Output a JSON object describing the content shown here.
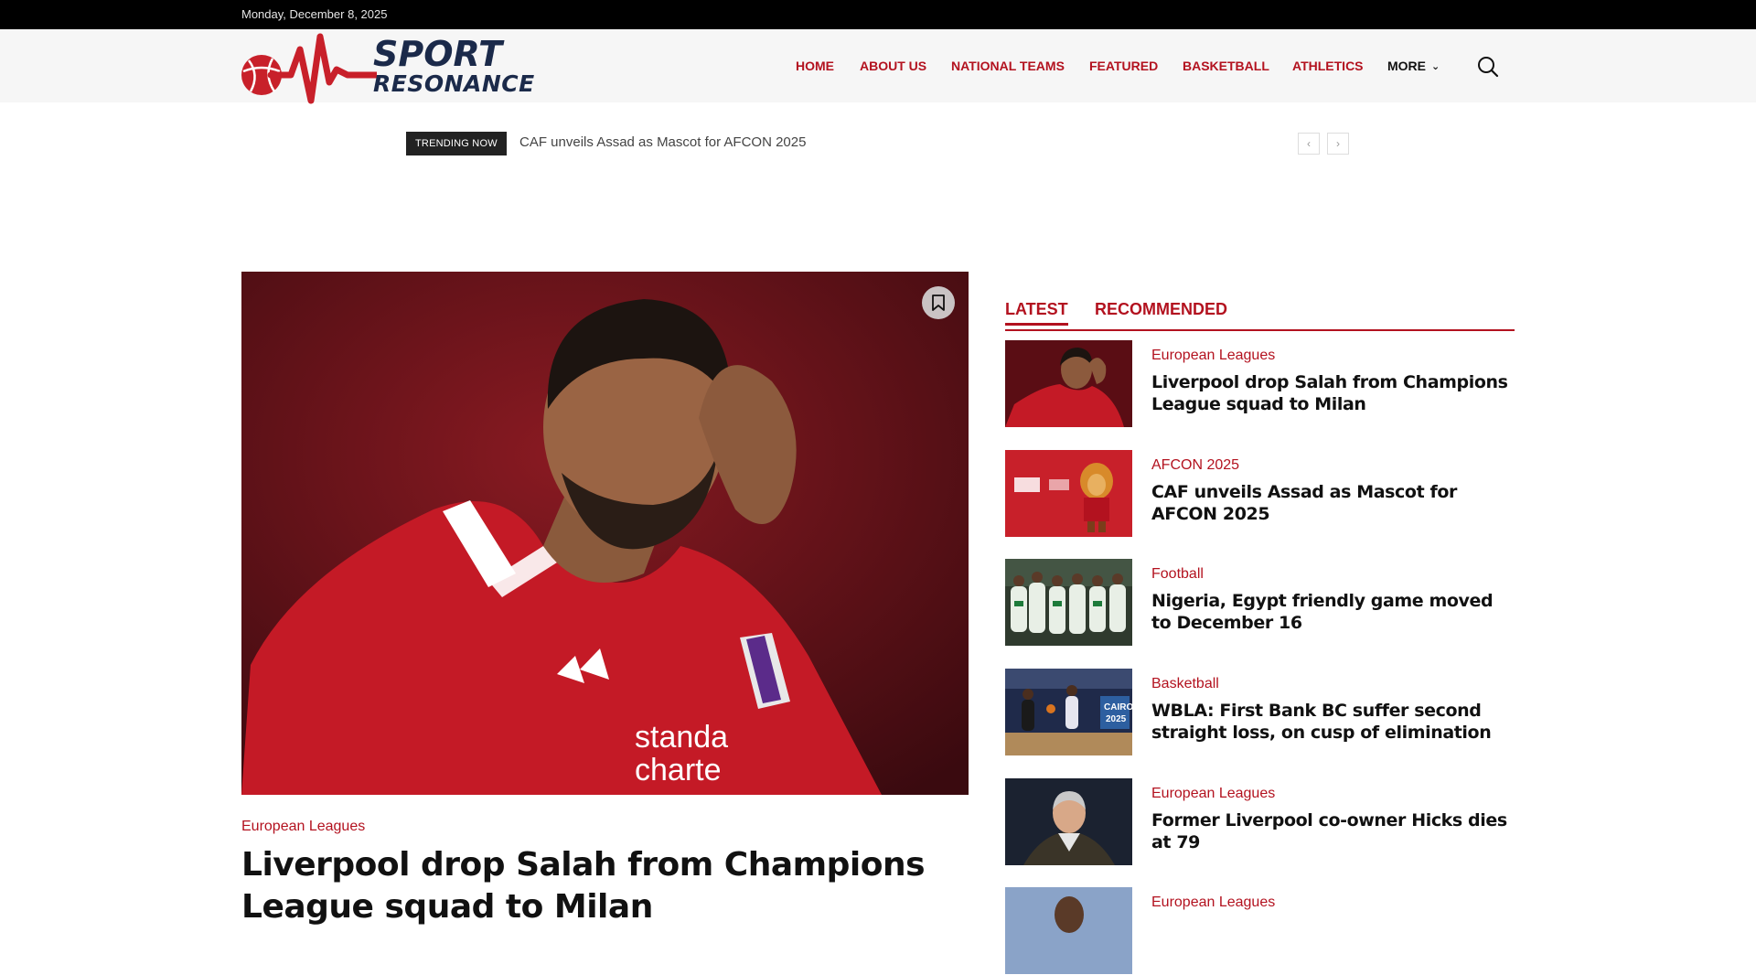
{
  "topbar": {
    "date": "Monday, December 8, 2025"
  },
  "logo": {
    "line1": "SPORT",
    "line2": "RESONANCE"
  },
  "nav": {
    "items": [
      "HOME",
      "ABOUT US",
      "NATIONAL TEAMS",
      "FEATURED",
      "BASKETBALL",
      "ATHLETICS",
      "MORE"
    ],
    "search_icon": "search-icon"
  },
  "trending": {
    "label": "TRENDING NOW",
    "headline": "CAF unveils Assad as Mascot for AFCON 2025",
    "prev": "‹",
    "next": "›"
  },
  "hero": {
    "category": "European Leagues",
    "title": "Liverpool drop Salah from Champions League squad to Milan"
  },
  "sidebar": {
    "tabs": [
      "LATEST",
      "RECOMMENDED"
    ],
    "posts": [
      {
        "category": "European Leagues",
        "title": "Liverpool drop Salah from Champions League squad to Milan"
      },
      {
        "category": "AFCON 2025",
        "title": "CAF unveils Assad as Mascot for AFCON 2025"
      },
      {
        "category": "Football",
        "title": "Nigeria, Egypt friendly game moved to December 16"
      },
      {
        "category": "Basketball",
        "title": "WBLA: First Bank BC suffer second straight loss, on cusp of elimination"
      },
      {
        "category": "European Leagues",
        "title": "Former Liverpool co-owner Hicks dies at 79"
      },
      {
        "category": "European Leagues",
        "title": ""
      }
    ]
  },
  "colors": {
    "brand_red": "#b3121f",
    "navy": "#1b2a4a",
    "topbar": "#000000"
  }
}
